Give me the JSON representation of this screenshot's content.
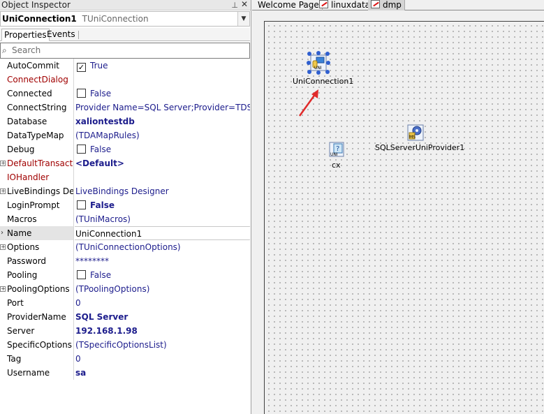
{
  "inspector": {
    "title": "Object Inspector",
    "pin_icon": "pin-icon",
    "close_icon": "close-icon",
    "component_name": "UniConnection1",
    "component_type": "TUniConnection",
    "tabs": {
      "properties": "Properties",
      "events": "Events"
    },
    "search_placeholder": "Search",
    "properties": [
      {
        "name": "AutoCommit",
        "value": "True",
        "checkbox": true,
        "checked": true
      },
      {
        "name": "ConnectDialog",
        "value": "",
        "red": true
      },
      {
        "name": "Connected",
        "value": "False",
        "checkbox": true,
        "checked": false
      },
      {
        "name": "ConnectString",
        "value": "Provider Name=SQL Server;Provider=TDS;Data"
      },
      {
        "name": "Database",
        "value": "xaliontestdb",
        "bold": true
      },
      {
        "name": "DataTypeMap",
        "value": "(TDAMapRules)"
      },
      {
        "name": "Debug",
        "value": "False",
        "checkbox": true,
        "checked": false
      },
      {
        "name": "DefaultTransaction",
        "value": "<Default>",
        "red": true,
        "bold": true,
        "expandable": true
      },
      {
        "name": "IOHandler",
        "value": "",
        "red": true
      },
      {
        "name": "LiveBindings Designer",
        "value": "LiveBindings Designer",
        "expandable": true
      },
      {
        "name": "LoginPrompt",
        "value": "False",
        "checkbox": true,
        "checked": false,
        "bold": true
      },
      {
        "name": "Macros",
        "value": "(TUniMacros)"
      },
      {
        "name": "Name",
        "value": "UniConnection1",
        "selected": true,
        "black": true
      },
      {
        "name": "Options",
        "value": "(TUniConnectionOptions)",
        "expandable": true
      },
      {
        "name": "Password",
        "value": "********"
      },
      {
        "name": "Pooling",
        "value": "False",
        "checkbox": true,
        "checked": false
      },
      {
        "name": "PoolingOptions",
        "value": "(TPoolingOptions)",
        "expandable": true
      },
      {
        "name": "Port",
        "value": "0"
      },
      {
        "name": "ProviderName",
        "value": "SQL Server",
        "bold": true
      },
      {
        "name": "Server",
        "value": "192.168.1.98",
        "bold": true
      },
      {
        "name": "SpecificOptions",
        "value": "(TSpecificOptionsList)"
      },
      {
        "name": "Tag",
        "value": "0"
      },
      {
        "name": "Username",
        "value": "sa",
        "bold": true
      }
    ]
  },
  "designer": {
    "tabs": [
      "Welcome Page",
      "linuxdata",
      "dmp"
    ],
    "active_tab": "dmp",
    "components": {
      "uniconnection": "UniConnection1",
      "sqlserver_provider": "SQLServerUniProvider1",
      "cx": "cx"
    },
    "arrow_color": "#e02a2a"
  }
}
